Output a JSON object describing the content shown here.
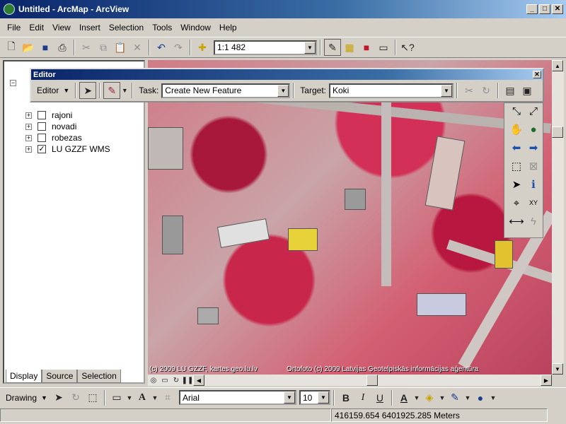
{
  "window": {
    "title": "Untitled - ArcMap - ArcView",
    "btn_min": "_",
    "btn_max": "□",
    "btn_close": "✕"
  },
  "menu": [
    "File",
    "Edit",
    "View",
    "Insert",
    "Selection",
    "Tools",
    "Window",
    "Help"
  ],
  "toolbar": {
    "scale_value": "1:1 482"
  },
  "editor": {
    "title": "Editor",
    "editor_menu": "Editor",
    "task_label": "Task:",
    "task_value": "Create New Feature",
    "target_label": "Target:",
    "target_value": "Koki",
    "close": "✕"
  },
  "toc": {
    "layers": [
      {
        "name": "rajoni",
        "checked": false
      },
      {
        "name": "novadi",
        "checked": false
      },
      {
        "name": "robezas",
        "checked": false
      },
      {
        "name": "LU GZZF WMS",
        "checked": true
      }
    ],
    "tabs": [
      "Display",
      "Source",
      "Selection"
    ]
  },
  "map": {
    "credit_left": "(c) 2009 LU GZZF, kartes.geo.lu.lv",
    "credit_right": "Ortofoto (c) 2009 Latvijas Ģeotelpiskās informācijas aģentūra"
  },
  "drawing": {
    "drawing_menu": "Drawing",
    "font_name": "Arial",
    "font_size": "10",
    "bold": "B",
    "italic": "I",
    "underline": "U",
    "font_color_letter": "A"
  },
  "status": {
    "coordinates": "416159.654  6401925.285 Meters"
  }
}
